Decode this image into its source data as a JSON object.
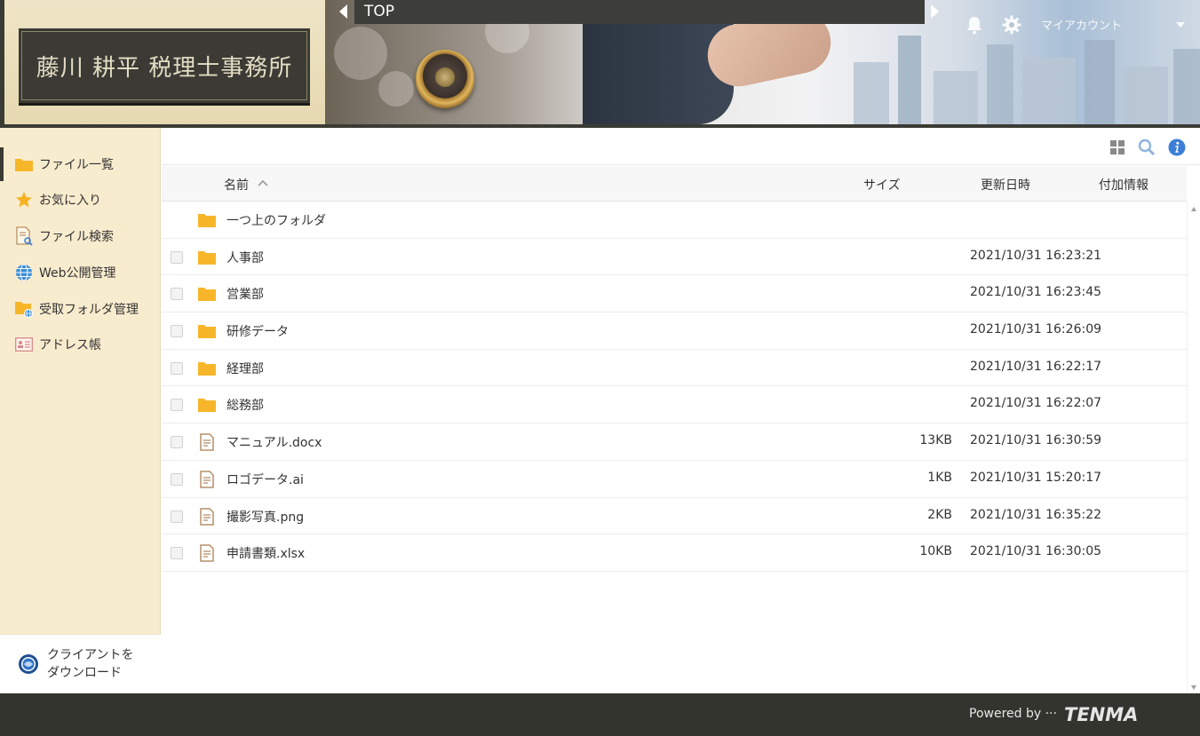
{
  "header": {
    "logo_text": "藤川 耕平 税理士事務所",
    "breadcrumb": "TOP",
    "account_label": "マイアカウント",
    "icons": {
      "notifications": "bell-icon",
      "settings": "gear-icon"
    }
  },
  "sidebar": {
    "items": [
      {
        "label": "ファイル一覧",
        "icon": "folder-icon",
        "active": true
      },
      {
        "label": "お気に入り",
        "icon": "star-icon"
      },
      {
        "label": "ファイル検索",
        "icon": "file-search-icon"
      },
      {
        "label": "Web公開管理",
        "icon": "globe-icon"
      },
      {
        "label": "受取フォルダ管理",
        "icon": "folder-globe-icon"
      },
      {
        "label": "アドレス帳",
        "icon": "address-card-icon"
      }
    ],
    "download": {
      "line1": "クライアントを",
      "line2": "ダウンロード",
      "icon": "client-download-icon"
    }
  },
  "toolbar": {
    "icons": [
      "grid-view-icon",
      "search-icon",
      "info-icon"
    ]
  },
  "table": {
    "columns": {
      "name": "名前",
      "size": "サイズ",
      "modified": "更新日時",
      "extra": "付加情報"
    },
    "parent_folder": "一つ上のフォルダ",
    "rows": [
      {
        "name": "人事部",
        "type": "folder",
        "size": "",
        "modified": "2021/10/31 16:23:21"
      },
      {
        "name": "営業部",
        "type": "folder",
        "size": "",
        "modified": "2021/10/31 16:23:45"
      },
      {
        "name": "研修データ",
        "type": "folder",
        "size": "",
        "modified": "2021/10/31 16:26:09"
      },
      {
        "name": "経理部",
        "type": "folder",
        "size": "",
        "modified": "2021/10/31 16:22:17"
      },
      {
        "name": "総務部",
        "type": "folder",
        "size": "",
        "modified": "2021/10/31 16:22:07"
      },
      {
        "name": "マニュアル.docx",
        "type": "file",
        "size": "13KB",
        "modified": "2021/10/31 16:30:59"
      },
      {
        "name": "ロゴデータ.ai",
        "type": "file",
        "size": "1KB",
        "modified": "2021/10/31 15:20:17"
      },
      {
        "name": "撮影写真.png",
        "type": "file",
        "size": "2KB",
        "modified": "2021/10/31 16:35:22"
      },
      {
        "name": "申請書類.xlsx",
        "type": "file",
        "size": "10KB",
        "modified": "2021/10/31 16:30:05"
      }
    ]
  },
  "footer": {
    "powered_by": "Powered by ···",
    "brand": "TENMA"
  },
  "colors": {
    "sidebar_bg": "#f8ecce",
    "dark": "#34342f",
    "folder": "#f7b62a",
    "accent_blue": "#3d7fd6"
  }
}
